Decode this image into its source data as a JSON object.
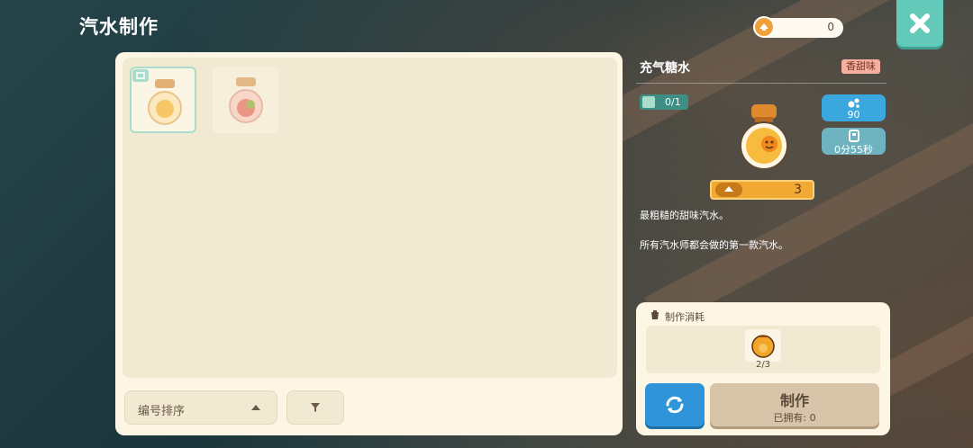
{
  "header": {
    "title": "汽水制作"
  },
  "currency": {
    "icon": "coin-icon",
    "value": "0"
  },
  "close": {
    "icon": "close-icon"
  },
  "list": {
    "sort_label": "编号排序",
    "filter_icon": "filter-icon",
    "items": [
      {
        "name": "orange-soda-jar",
        "selected": true,
        "accent": "#f6b34a"
      },
      {
        "name": "strawberry-soda-jar",
        "selected": false,
        "accent": "#e7685a"
      }
    ]
  },
  "detail": {
    "name": "充气糖水",
    "flavor": "香甜味",
    "owned_count": "0/1",
    "fizz_value": "90",
    "brew_time": "0分55秒",
    "price": "3",
    "description_line1": "最粗糙的甜味汽水。",
    "description_line2": "所有汽水师都会做的第一款汽水。"
  },
  "cost": {
    "title": "制作消耗",
    "material_count": "2/3"
  },
  "actions": {
    "make_label": "制作",
    "owned_label": "已拥有: 0"
  }
}
